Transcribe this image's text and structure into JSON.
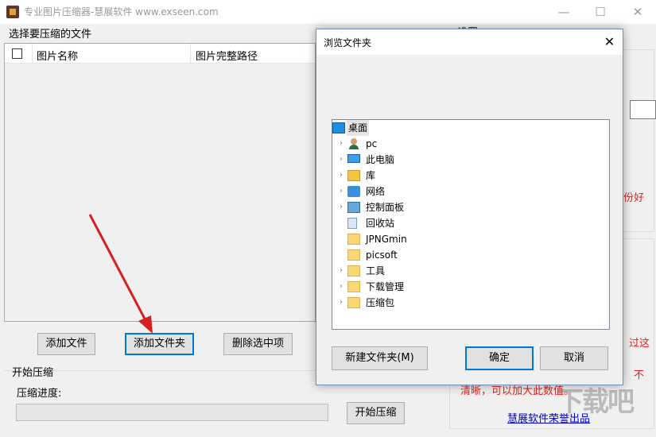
{
  "window": {
    "title": "专业图片压缩器-慧展软件 www.exseen.com",
    "minimize": "—",
    "maximize": "☐",
    "close": "✕"
  },
  "files_group": {
    "label": "选择要压缩的文件",
    "columns": [
      "图片名称",
      "图片完整路径"
    ]
  },
  "buttons": {
    "add_file": "添加文件",
    "add_folder": "添加文件夹",
    "delete_selected": "删除选中项",
    "start": "开始压缩"
  },
  "start_group": {
    "label": "开始压缩",
    "progress_label": "压缩进度:",
    "progress": 0
  },
  "settings": {
    "label": "设置",
    "red_text_1": "份好",
    "red_text_2": "过这",
    "red_text_3": "不",
    "red_text_4": "清晰，可以加大此数值。"
  },
  "brand_link": "慧展软件荣誉出品",
  "watermark": "下载吧",
  "dialog": {
    "title": "浏览文件夹",
    "close": "✕",
    "tree": [
      {
        "label": "桌面",
        "icon": "desktop-icon",
        "expandable": false,
        "level": 0,
        "selected": true
      },
      {
        "label": "pc",
        "icon": "user-icon",
        "expandable": true,
        "level": 1
      },
      {
        "label": "此电脑",
        "icon": "computer-icon",
        "expandable": true,
        "level": 1
      },
      {
        "label": "库",
        "icon": "library-icon",
        "expandable": true,
        "level": 1
      },
      {
        "label": "网络",
        "icon": "network-icon",
        "expandable": true,
        "level": 1
      },
      {
        "label": "控制面板",
        "icon": "control-panel-icon",
        "expandable": true,
        "level": 1
      },
      {
        "label": "回收站",
        "icon": "recycle-bin-icon",
        "expandable": false,
        "level": 1
      },
      {
        "label": "JPNGmin",
        "icon": "folder-icon",
        "expandable": false,
        "level": 1
      },
      {
        "label": "picsoft",
        "icon": "folder-icon",
        "expandable": false,
        "level": 1
      },
      {
        "label": "工具",
        "icon": "folder-icon",
        "expandable": true,
        "level": 1
      },
      {
        "label": "下载管理",
        "icon": "folder-icon",
        "expandable": true,
        "level": 1
      },
      {
        "label": "压缩包",
        "icon": "folder-icon",
        "expandable": true,
        "level": 1
      }
    ],
    "new_folder": "新建文件夹(M)",
    "ok": "确定",
    "cancel": "取消"
  },
  "colors": {
    "accent": "#0078d7",
    "warning_text": "#e02020",
    "link": "#0000cc",
    "arrow": "#d42020"
  }
}
